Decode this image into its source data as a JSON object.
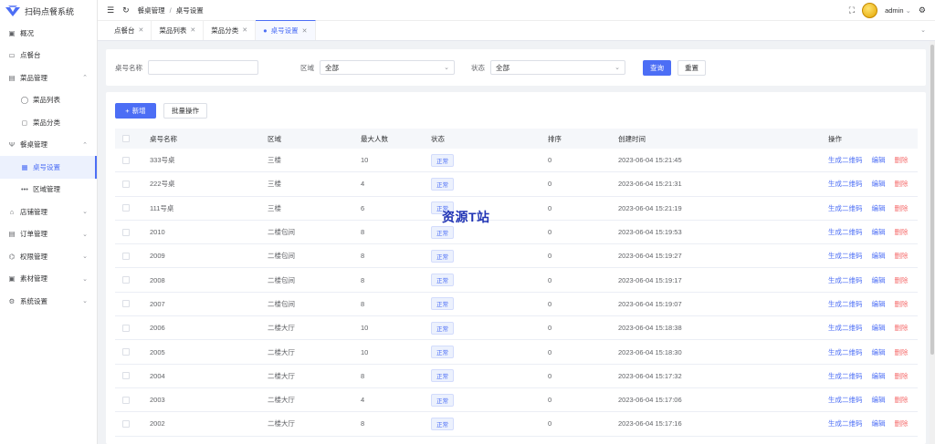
{
  "app": {
    "title": "扫码点餐系统"
  },
  "sidebar": {
    "items": [
      {
        "icon": "▣",
        "label": "概况",
        "level": 0,
        "active": false,
        "chevron": ""
      },
      {
        "icon": "▭",
        "label": "点餐台",
        "level": 0,
        "active": false,
        "chevron": ""
      },
      {
        "icon": "▤",
        "label": "菜品管理",
        "level": 0,
        "active": false,
        "chevron": "⌃"
      },
      {
        "icon": "◯",
        "label": "菜品列表",
        "level": 1,
        "active": false,
        "chevron": ""
      },
      {
        "icon": "◻",
        "label": "菜品分类",
        "level": 1,
        "active": false,
        "chevron": ""
      },
      {
        "icon": "Ψ",
        "label": "餐桌管理",
        "level": 0,
        "active": false,
        "chevron": "⌃"
      },
      {
        "icon": "▦",
        "label": "桌号设置",
        "level": 1,
        "active": true,
        "chevron": ""
      },
      {
        "icon": "•••",
        "label": "区域管理",
        "level": 1,
        "active": false,
        "chevron": ""
      },
      {
        "icon": "⌂",
        "label": "店铺管理",
        "level": 0,
        "active": false,
        "chevron": "⌄"
      },
      {
        "icon": "▤",
        "label": "订单管理",
        "level": 0,
        "active": false,
        "chevron": "⌄"
      },
      {
        "icon": "⌬",
        "label": "权限管理",
        "level": 0,
        "active": false,
        "chevron": "⌄"
      },
      {
        "icon": "▣",
        "label": "素材管理",
        "level": 0,
        "active": false,
        "chevron": "⌄"
      },
      {
        "icon": "⚙",
        "label": "系统设置",
        "level": 0,
        "active": false,
        "chevron": "⌄"
      }
    ]
  },
  "header": {
    "breadcrumb": [
      "餐桌管理",
      "桌号设置"
    ],
    "breadcrumb_sep": "/",
    "user": "admin"
  },
  "tabs": [
    {
      "label": "点餐台",
      "active": false
    },
    {
      "label": "菜品列表",
      "active": false
    },
    {
      "label": "菜品分类",
      "active": false
    },
    {
      "label": "桌号设置",
      "active": true
    }
  ],
  "filter": {
    "name_label": "桌号名称",
    "area_label": "区域",
    "area_value": "全部",
    "status_label": "状态",
    "status_value": "全部",
    "query_button": "查询",
    "reset_button": "重置"
  },
  "toolbar": {
    "add_button": "新增",
    "batch_button": "批量操作"
  },
  "table": {
    "columns": [
      "桌号名称",
      "区域",
      "最大人数",
      "状态",
      "排序",
      "创建时间",
      "操作"
    ],
    "rows": [
      {
        "name": "333号桌",
        "area": "三楼",
        "max": "10",
        "status": "正常",
        "sort": "0",
        "created": "2023-06-04 15:21:45"
      },
      {
        "name": "222号桌",
        "area": "三楼",
        "max": "4",
        "status": "正常",
        "sort": "0",
        "created": "2023-06-04 15:21:31"
      },
      {
        "name": "111号桌",
        "area": "三楼",
        "max": "6",
        "status": "正常",
        "sort": "0",
        "created": "2023-06-04 15:21:19"
      },
      {
        "name": "2010",
        "area": "二楼包间",
        "max": "8",
        "status": "正常",
        "sort": "0",
        "created": "2023-06-04 15:19:53"
      },
      {
        "name": "2009",
        "area": "二楼包间",
        "max": "8",
        "status": "正常",
        "sort": "0",
        "created": "2023-06-04 15:19:27"
      },
      {
        "name": "2008",
        "area": "二楼包间",
        "max": "8",
        "status": "正常",
        "sort": "0",
        "created": "2023-06-04 15:19:17"
      },
      {
        "name": "2007",
        "area": "二楼包间",
        "max": "8",
        "status": "正常",
        "sort": "0",
        "created": "2023-06-04 15:19:07"
      },
      {
        "name": "2006",
        "area": "二楼大厅",
        "max": "10",
        "status": "正常",
        "sort": "0",
        "created": "2023-06-04 15:18:38"
      },
      {
        "name": "2005",
        "area": "二楼大厅",
        "max": "10",
        "status": "正常",
        "sort": "0",
        "created": "2023-06-04 15:18:30"
      },
      {
        "name": "2004",
        "area": "二楼大厅",
        "max": "8",
        "status": "正常",
        "sort": "0",
        "created": "2023-06-04 15:17:32"
      },
      {
        "name": "2003",
        "area": "二楼大厅",
        "max": "4",
        "status": "正常",
        "sort": "0",
        "created": "2023-06-04 15:17:06"
      },
      {
        "name": "2002",
        "area": "二楼大厅",
        "max": "8",
        "status": "正常",
        "sort": "0",
        "created": "2023-06-04 15:17:16"
      }
    ],
    "ops": {
      "qrcode": "生成二维码",
      "edit": "编辑",
      "delete": "删除"
    }
  },
  "watermark": "资源T站",
  "colors": {
    "primary": "#4c6ef5",
    "danger": "#f56c6c",
    "watermark": "#2235b5"
  }
}
